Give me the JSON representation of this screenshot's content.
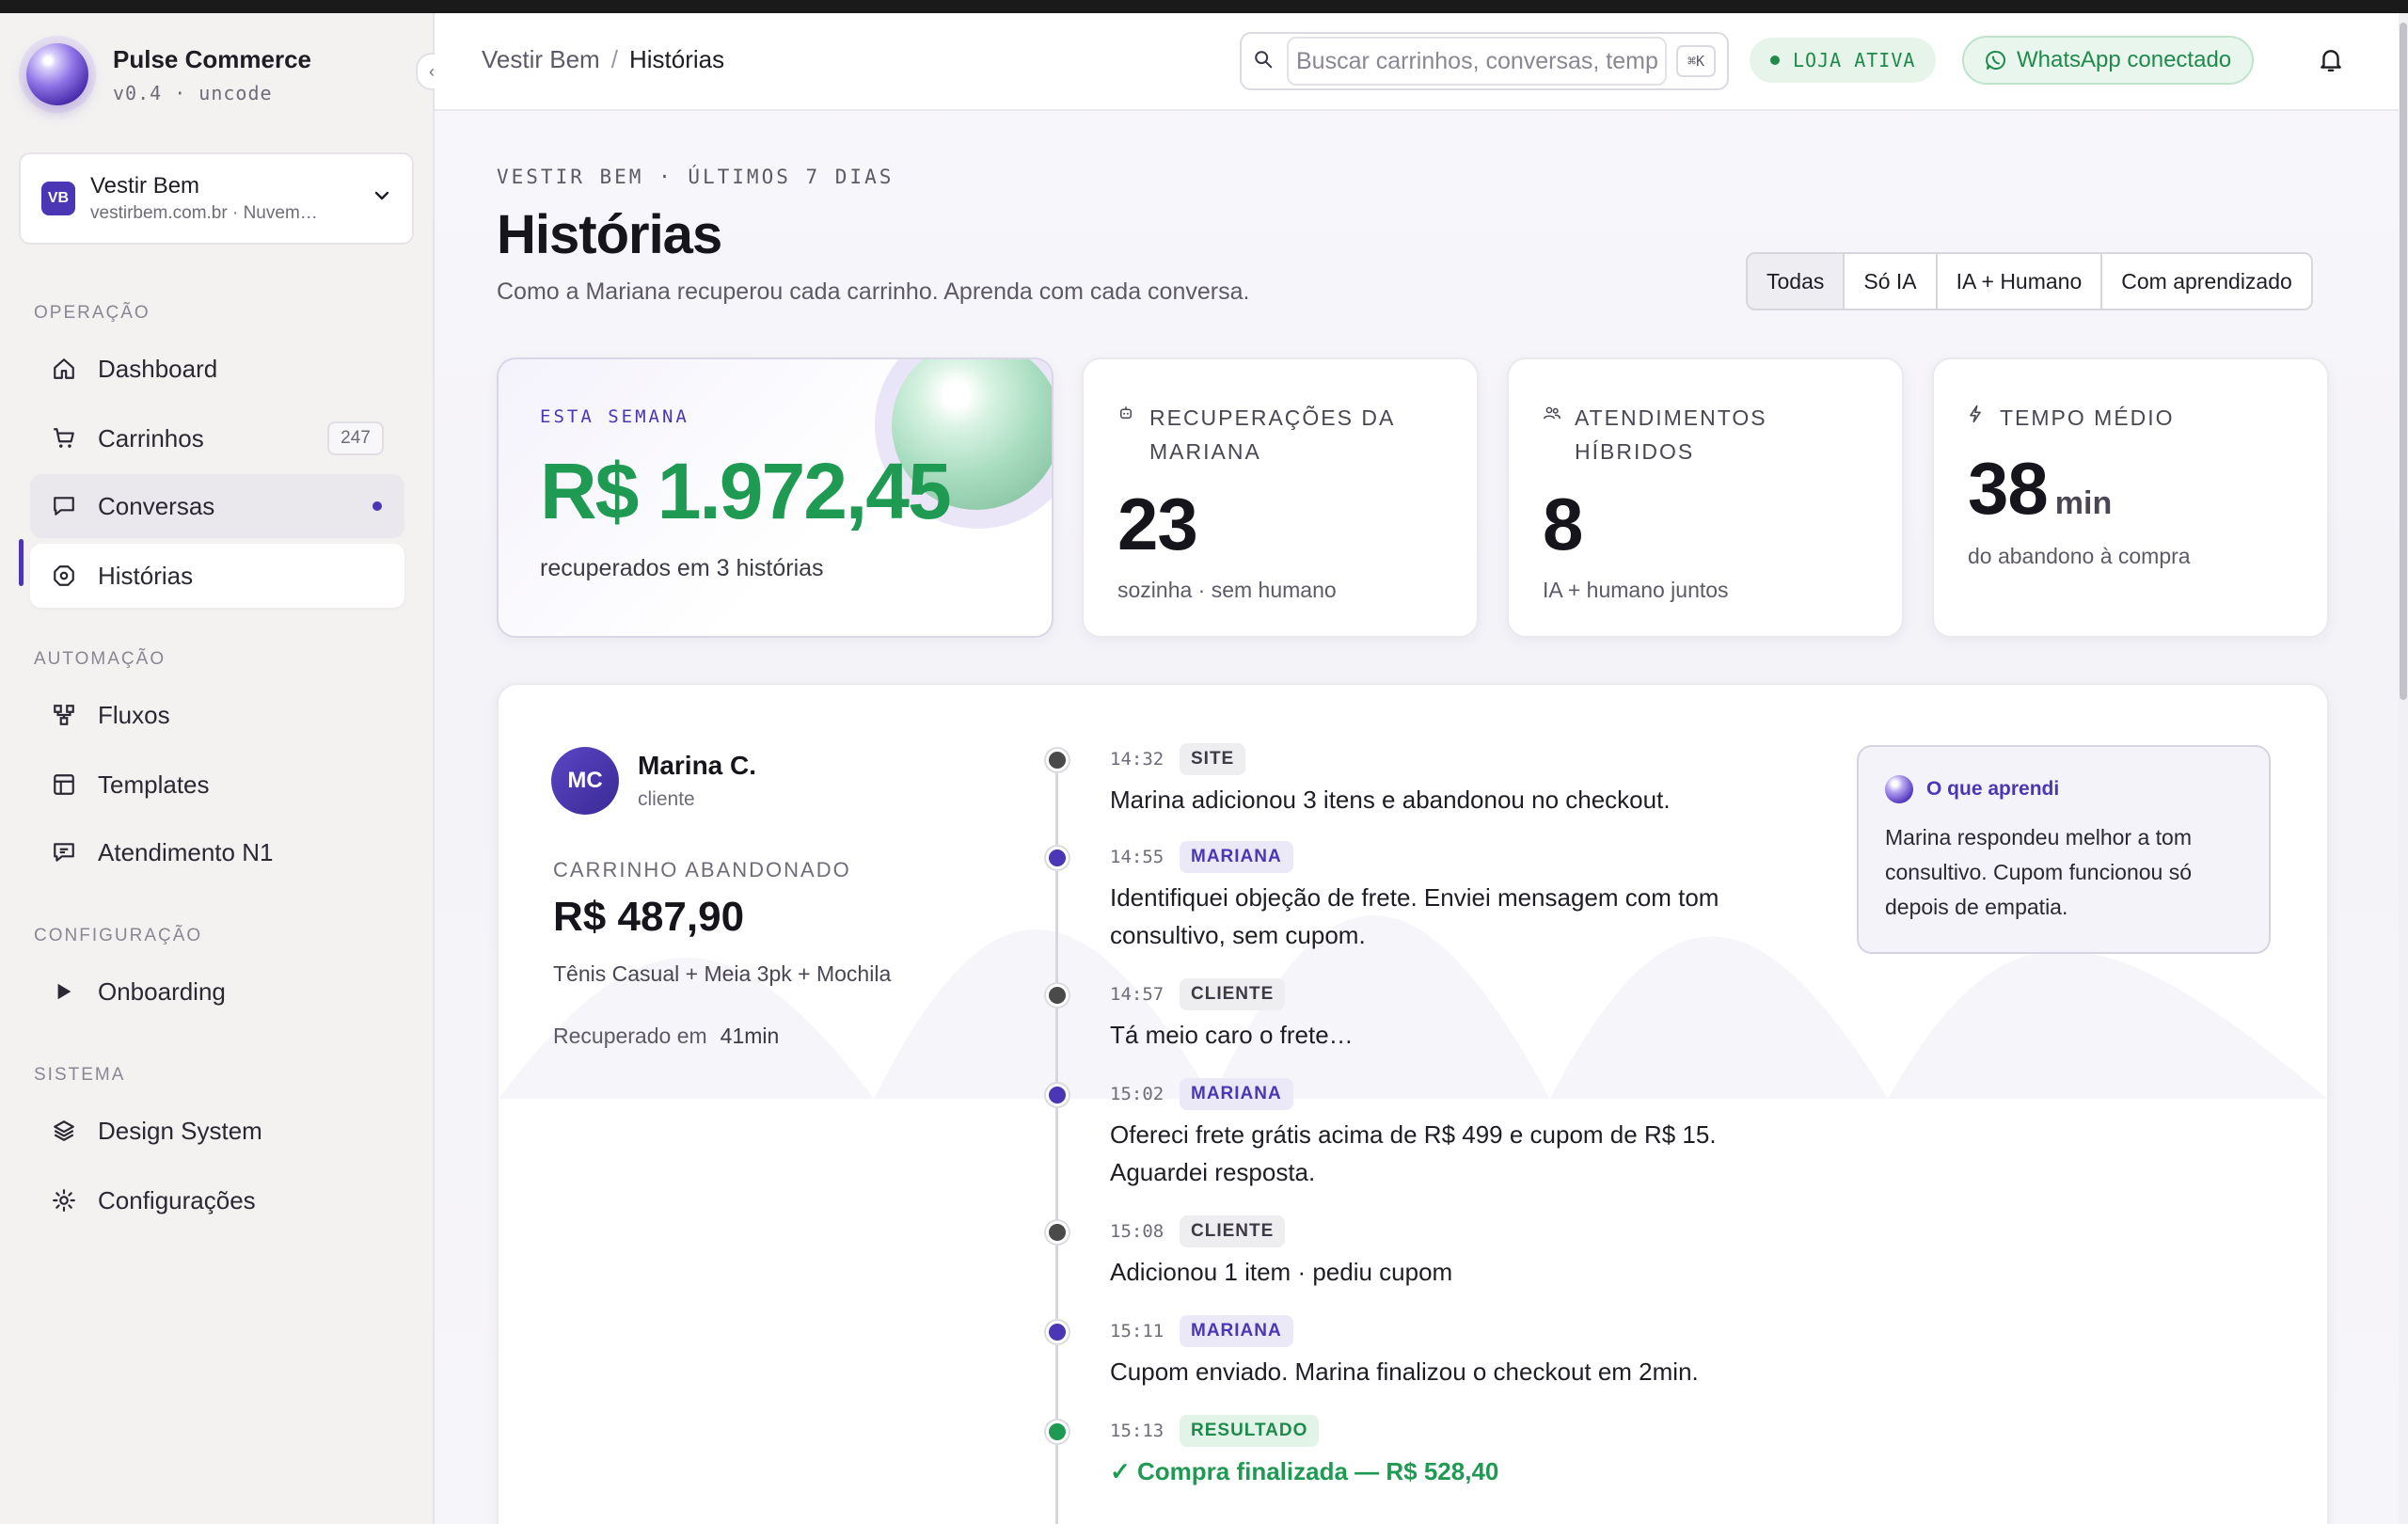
{
  "app": {
    "name": "Pulse Commerce",
    "version": "v0.4 · uncode",
    "collapse_icon": "chevron-left-icon"
  },
  "store": {
    "initials": "VB",
    "name": "Vestir Bem",
    "subtitle": "vestirbem.com.br · Nuvem…"
  },
  "sidebar": {
    "sections": [
      {
        "label": "OPERAÇÃO",
        "items": [
          {
            "label": "Dashboard",
            "icon": "home-icon"
          },
          {
            "label": "Carrinhos",
            "icon": "cart-icon",
            "badge": "247"
          },
          {
            "label": "Conversas",
            "icon": "chat-icon",
            "unread": true
          },
          {
            "label": "Histórias",
            "icon": "history-icon",
            "active": true
          }
        ]
      },
      {
        "label": "AUTOMAÇÃO",
        "items": [
          {
            "label": "Fluxos",
            "icon": "flow-icon"
          },
          {
            "label": "Templates",
            "icon": "template-icon"
          },
          {
            "label": "Atendimento N1",
            "icon": "support-chat-icon"
          }
        ]
      },
      {
        "label": "CONFIGURAÇÃO",
        "items": [
          {
            "label": "Onboarding",
            "icon": "play-icon"
          }
        ]
      },
      {
        "label": "SISTEMA",
        "items": [
          {
            "label": "Design System",
            "icon": "layers-icon"
          },
          {
            "label": "Configurações",
            "icon": "settings-icon"
          }
        ]
      }
    ]
  },
  "header": {
    "breadcrumb": [
      "Vestir Bem",
      "Histórias"
    ],
    "search_placeholder": "Buscar carrinhos, conversas, templates",
    "search_shortcut": "⌘K",
    "store_status": "LOJA ATIVA",
    "whatsapp_status": "WhatsApp conectado"
  },
  "page": {
    "eyebrow": "VESTIR BEM · ÚLTIMOS 7 DIAS",
    "title": "Histórias",
    "subtitle": "Como a Mariana recuperou cada carrinho. Aprenda com cada conversa.",
    "filters": [
      "Todas",
      "Só IA",
      "IA + Humano",
      "Com aprendizado"
    ],
    "selected_filter": "Todas"
  },
  "stats": {
    "hero": {
      "label": "ESTA SEMANA",
      "value": "R$ 1.972,45",
      "sub": "recuperados em 3 histórias"
    },
    "cards": [
      {
        "label": "RECUPERAÇÕES DA MARIANA",
        "value": "23",
        "unit": "",
        "sub": "sozinha · sem humano",
        "icon": "bot-icon"
      },
      {
        "label": "ATENDIMENTOS HÍBRIDOS",
        "value": "8",
        "unit": "",
        "sub": "IA + humano juntos",
        "icon": "users-icon"
      },
      {
        "label": "TEMPO MÉDIO",
        "value": "38",
        "unit": "min",
        "sub": "do abandono à compra",
        "icon": "bolt-icon"
      }
    ]
  },
  "story": {
    "customer": {
      "initials": "MC",
      "name": "Marina C.",
      "role": "cliente"
    },
    "cart_label": "CARRINHO ABANDONADO",
    "cart_value": "R$ 487,90",
    "cart_items": "Tênis Casual + Meia 3pk + Mochila",
    "recovered_label": "Recuperado em",
    "recovered_time": "41min",
    "events": [
      {
        "time": "14:32",
        "tag": "SITE",
        "kind": "site",
        "text": "Marina adicionou 3 itens e abandonou no checkout."
      },
      {
        "time": "14:55",
        "tag": "MARIANA",
        "kind": "mariana",
        "text": "Identifiquei objeção de frete. Enviei mensagem com tom consultivo, sem cupom."
      },
      {
        "time": "14:57",
        "tag": "CLIENTE",
        "kind": "cliente",
        "text": "Tá meio caro o frete…"
      },
      {
        "time": "15:02",
        "tag": "MARIANA",
        "kind": "mariana",
        "text": "Ofereci frete grátis acima de R$ 499 e cupom de R$ 15. Aguardei resposta."
      },
      {
        "time": "15:08",
        "tag": "CLIENTE",
        "kind": "cliente",
        "text": "Adicionou 1 item · pediu cupom"
      },
      {
        "time": "15:11",
        "tag": "MARIANA",
        "kind": "mariana",
        "text": "Cupom enviado. Marina finalizou o checkout em 2min."
      },
      {
        "time": "15:13",
        "tag": "RESULTADO",
        "kind": "resultado",
        "text": "✓ Compra finalizada — R$ 528,40"
      }
    ],
    "learning": {
      "title": "O que aprendi",
      "body": "Marina respondeu melhor a tom consultivo. Cupom funcionou só depois de empatia."
    }
  },
  "colors": {
    "accent": "#4b36b5",
    "success": "#1f9a52",
    "sidebar_bg": "#f3f2f1"
  }
}
